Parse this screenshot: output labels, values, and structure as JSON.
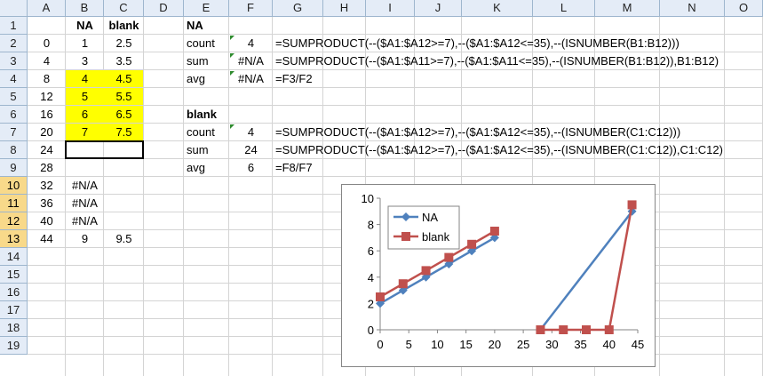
{
  "columns": [
    "A",
    "B",
    "C",
    "D",
    "E",
    "F",
    "G",
    "H",
    "I",
    "J",
    "K",
    "L",
    "M",
    "N",
    "O"
  ],
  "rows": [
    "1",
    "2",
    "3",
    "4",
    "5",
    "6",
    "7",
    "8",
    "9",
    "10",
    "11",
    "12",
    "13",
    "14",
    "15",
    "16",
    "17",
    "18",
    "19"
  ],
  "cells": {
    "B1": "NA",
    "C1": "blank",
    "E1": "NA",
    "A2": "0",
    "B2": "1",
    "C2": "2.5",
    "E2": "count",
    "F2": "4",
    "G2": "=SUMPRODUCT(--($A1:$A12>=7),--($A1:$A12<=35),--(ISNUMBER(B1:B12)))",
    "A3": "4",
    "B3": "3",
    "C3": "3.5",
    "E3": "sum",
    "F3": "#N/A",
    "G3": "=SUMPRODUCT(--($A1:$A11>=7),--($A1:$A11<=35),--(ISNUMBER(B1:B12)),B1:B12)",
    "A4": "8",
    "B4": "4",
    "C4": "4.5",
    "E4": "avg",
    "F4": "#N/A",
    "G4": "=F3/F2",
    "A5": "12",
    "B5": "5",
    "C5": "5.5",
    "A6": "16",
    "B6": "6",
    "C6": "6.5",
    "E6": "blank",
    "A7": "20",
    "B7": "7",
    "C7": "7.5",
    "E7": "count",
    "F7": "4",
    "G7": "=SUMPRODUCT(--($A1:$A12>=7),--($A1:$A12<=35),--(ISNUMBER(C1:C12)))",
    "A8": "24",
    "E8": "sum",
    "F8": "24",
    "G8": "=SUMPRODUCT(--($A1:$A12>=7),--($A1:$A12<=35),--(ISNUMBER(C1:C12)),C1:C12)",
    "A9": "28",
    "E9": "avg",
    "F9": "6",
    "G9": "=F8/F7",
    "A10": "32",
    "B10": "#N/A",
    "A11": "36",
    "B11": "#N/A",
    "A12": "40",
    "B12": "#N/A",
    "A13": "44",
    "B13": "9",
    "C13": "9.5"
  },
  "colors": {
    "yellow_fill": "#ffff00",
    "na_series": "#4f81bd",
    "blank_series": "#c0504d"
  },
  "chart_data": {
    "type": "line",
    "x_ticks": [
      "0",
      "5",
      "10",
      "15",
      "20",
      "25",
      "30",
      "35",
      "40",
      "45"
    ],
    "y_ticks": [
      "0",
      "2",
      "4",
      "6",
      "8",
      "10"
    ],
    "xlim": [
      0,
      45
    ],
    "ylim": [
      0,
      10
    ],
    "legend_placement": "top-left",
    "series": [
      {
        "name": "NA",
        "marker": "diamond",
        "color": "#4f81bd",
        "points": [
          [
            0,
            2
          ],
          [
            4,
            3
          ],
          [
            8,
            4
          ],
          [
            12,
            5
          ],
          [
            16,
            6
          ],
          [
            20,
            7
          ],
          null,
          [
            28,
            0
          ],
          [
            44,
            9
          ]
        ]
      },
      {
        "name": "blank",
        "marker": "square",
        "color": "#c0504d",
        "points": [
          [
            0,
            2.5
          ],
          [
            4,
            3.5
          ],
          [
            8,
            4.5
          ],
          [
            12,
            5.5
          ],
          [
            16,
            6.5
          ],
          [
            20,
            7.5
          ],
          null,
          [
            28,
            0
          ],
          [
            32,
            0
          ],
          [
            36,
            0
          ],
          [
            40,
            0
          ],
          [
            44,
            9.5
          ]
        ]
      }
    ]
  }
}
